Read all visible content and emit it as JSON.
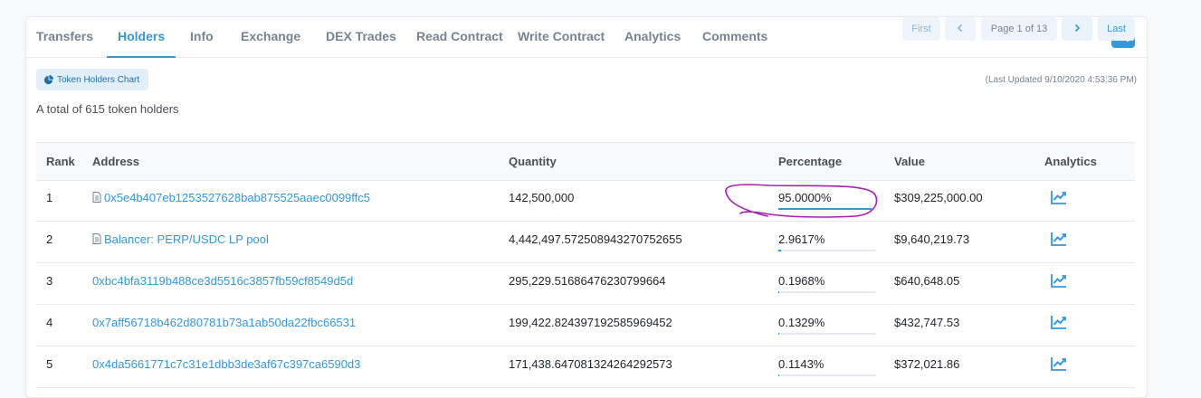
{
  "tabs": [
    {
      "label": "Transfers",
      "active": false
    },
    {
      "label": "Holders",
      "active": true
    },
    {
      "label": "Info",
      "active": false
    },
    {
      "label": "Exchange",
      "active": false
    },
    {
      "label": "DEX Trades",
      "active": false
    },
    {
      "label": "Read Contract",
      "active": false
    },
    {
      "label": "Write Contract",
      "active": false
    },
    {
      "label": "Analytics",
      "active": false
    },
    {
      "label": "Comments",
      "active": false
    }
  ],
  "search_icon": "search-icon",
  "holders_chart_button": {
    "label": "Token Holders Chart",
    "icon": "pie-chart-icon"
  },
  "last_updated": "(Last Updated 9/10/2020 4:53:36 PM)",
  "total_text": "A total of 615 token holders",
  "pagination": {
    "first": "First",
    "prev_icon": "chevron-left-icon",
    "page_info": "Page 1 of 13",
    "next_icon": "chevron-right-icon",
    "last": "Last"
  },
  "table": {
    "headers": [
      "Rank",
      "Address",
      "Quantity",
      "Percentage",
      "Value",
      "Analytics"
    ],
    "rows": [
      {
        "rank": "1",
        "address": "0x5e4b407eb1253527628bab875525aaec0099ffc5",
        "contract": true,
        "quantity": "142,500,000",
        "percentage": "95.0000%",
        "pct_value": 95.0,
        "value": "$309,225,000.00"
      },
      {
        "rank": "2",
        "address": "Balancer: PERP/USDC LP pool",
        "contract": true,
        "quantity": "4,442,497.572508943270752655",
        "percentage": "2.9617%",
        "pct_value": 2.9617,
        "value": "$9,640,219.73"
      },
      {
        "rank": "3",
        "address": "0xbc4bfa3119b488ce3d5516c3857fb59cf8549d5d",
        "contract": false,
        "quantity": "295,229.51686476230799664",
        "percentage": "0.1968%",
        "pct_value": 0.1968,
        "value": "$640,648.05"
      },
      {
        "rank": "4",
        "address": "0x7aff56718b462d80781b73a1ab50da22fbc66531",
        "contract": false,
        "quantity": "199,422.824397192585969452",
        "percentage": "0.1329%",
        "pct_value": 0.1329,
        "value": "$432,747.53"
      },
      {
        "rank": "5",
        "address": "0x4da5661771c7c31e1dbb3de3af67c397ca6590d3",
        "contract": false,
        "quantity": "171,438.647081324264292573",
        "percentage": "0.1143%",
        "pct_value": 0.1143,
        "value": "$372,021.86"
      }
    ]
  },
  "colors": {
    "accent": "#3498db",
    "annotation": "#a61fb0"
  }
}
